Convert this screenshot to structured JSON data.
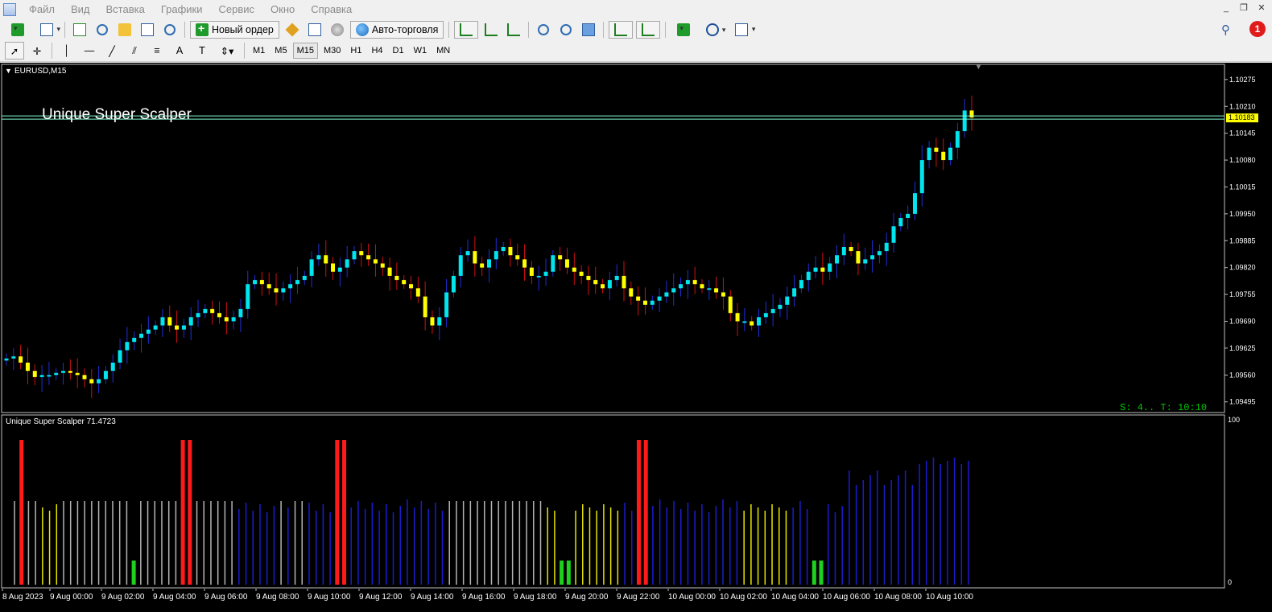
{
  "menu": {
    "items": [
      "Файл",
      "Вид",
      "Вставка",
      "Графики",
      "Сервис",
      "Окно",
      "Справка"
    ]
  },
  "window_controls": [
    "minimize-icon",
    "restore-icon",
    "close-icon"
  ],
  "toolbar": {
    "new_order_label": "Новый ордер",
    "autotrade_label": "Авто-торговля",
    "notifications_count": "1",
    "timeframes": [
      "M1",
      "M5",
      "M15",
      "M30",
      "H1",
      "H4",
      "D1",
      "W1",
      "MN"
    ],
    "active_timeframe": "M15"
  },
  "chart": {
    "symbol_label": "EURUSD,M15",
    "overlay_title": "Unique Super Scalper",
    "current_price": "1.10183",
    "status_text": "S: 4.. T: 10:10",
    "price_ticks": [
      "1.10275",
      "1.10210",
      "1.10145",
      "1.10080",
      "1.10015",
      "1.09950",
      "1.09885",
      "1.09820",
      "1.09755",
      "1.09690",
      "1.09625",
      "1.09560",
      "1.09495"
    ],
    "time_ticks": [
      "8 Aug 2023",
      "9 Aug 00:00",
      "9 Aug 02:00",
      "9 Aug 04:00",
      "9 Aug 06:00",
      "9 Aug 08:00",
      "9 Aug 10:00",
      "9 Aug 12:00",
      "9 Aug 14:00",
      "9 Aug 16:00",
      "9 Aug 18:00",
      "9 Aug 20:00",
      "9 Aug 22:00",
      "10 Aug 00:00",
      "10 Aug 02:00",
      "10 Aug 04:00",
      "10 Aug 06:00",
      "10 Aug 08:00",
      "10 Aug 10:00"
    ],
    "colors": {
      "background": "#000000",
      "bull_candle": "#00e5ee",
      "bear_candle": "#ffff00",
      "wick_bull": "#1f2fd8",
      "wick_bear": "#d01010",
      "price_line": "#7fffd4",
      "price_tag_bg": "#ffff00",
      "status_text": "#00c800"
    }
  },
  "indicator": {
    "label": "Unique Super Scalper 71.4723",
    "scale_max": "100",
    "scale_min": "0",
    "colors": {
      "blue": "#1c1ccf",
      "gray": "#b4b4b4",
      "yellow": "#e6e600",
      "red": "#ff1a1a",
      "green": "#1fd11f"
    }
  },
  "chart_data": {
    "type": "candlestick",
    "symbol": "EURUSD",
    "timeframe": "M15",
    "ylim": [
      1.09475,
      1.103
    ],
    "price_series": [
      1.096,
      1.09605,
      1.0959,
      1.0957,
      1.09555,
      1.0956,
      1.0956,
      1.09565,
      1.0957,
      1.09565,
      1.0956,
      1.0955,
      1.0954,
      1.0955,
      1.0957,
      1.0959,
      1.0962,
      1.0964,
      1.0965,
      1.0966,
      1.0967,
      1.0968,
      1.097,
      1.0968,
      1.0967,
      1.0968,
      1.097,
      1.0971,
      1.0972,
      1.0971,
      1.097,
      1.0969,
      1.097,
      1.0972,
      1.0978,
      1.0979,
      1.0978,
      1.0977,
      1.0976,
      1.0977,
      1.0978,
      1.0979,
      1.098,
      1.0984,
      1.0985,
      1.0983,
      1.0981,
      1.0982,
      1.0984,
      1.0986,
      1.0985,
      1.0984,
      1.0983,
      1.0982,
      1.098,
      1.0979,
      1.0978,
      1.0977,
      1.0975,
      1.097,
      1.0968,
      1.097,
      1.0976,
      1.098,
      1.0985,
      1.0986,
      1.0983,
      1.0982,
      1.0984,
      1.0986,
      1.0987,
      1.0985,
      1.0984,
      1.0982,
      1.098,
      1.098,
      1.0981,
      1.0985,
      1.0984,
      1.0982,
      1.0981,
      1.098,
      1.0979,
      1.0978,
      1.0977,
      1.0979,
      1.098,
      1.0977,
      1.0975,
      1.0974,
      1.0973,
      1.0974,
      1.0975,
      1.0976,
      1.0977,
      1.0978,
      1.0979,
      1.0978,
      1.0977,
      1.0977,
      1.0976,
      1.0975,
      1.0971,
      1.0969,
      1.0969,
      1.0968,
      1.097,
      1.0971,
      1.0972,
      1.0973,
      1.0975,
      1.0977,
      1.0979,
      1.0981,
      1.0982,
      1.0981,
      1.0983,
      1.0985,
      1.0987,
      1.0986,
      1.0983,
      1.0984,
      1.0985,
      1.0986,
      1.0988,
      1.0992,
      1.0994,
      1.0995,
      1.1,
      1.1008,
      1.1011,
      1.101,
      1.1008,
      1.1011,
      1.1015,
      1.102,
      1.10183
    ],
    "indicator_values": "oscillator 0–100; bars mostly 20–65, spikes to ~95"
  }
}
